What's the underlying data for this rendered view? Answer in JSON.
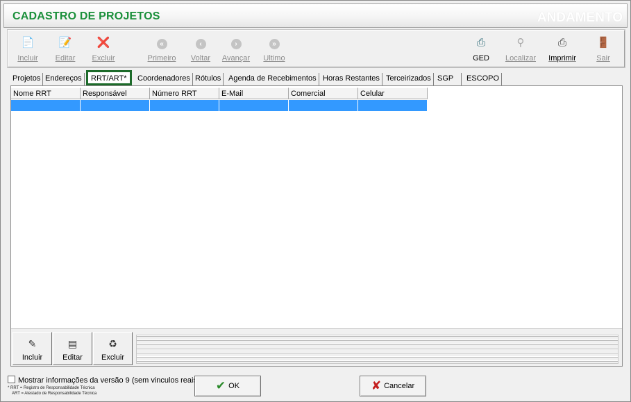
{
  "header": {
    "title": "CADASTRO DE PROJETOS",
    "status": "ANDAMENTO"
  },
  "toolbar": {
    "incluir": "Incluir",
    "editar": "Editar",
    "excluir": "Excluir",
    "primeiro": "Primeiro",
    "voltar": "Voltar",
    "avancar": "Avançar",
    "ultimo": "Ultimo",
    "ged": "GED",
    "localizar": "Localizar",
    "imprimir": "Imprimir",
    "sair": "Sair"
  },
  "tabs": [
    {
      "label": "Projetos"
    },
    {
      "label": "Endereços"
    },
    {
      "label": "RRT/ART*"
    },
    {
      "label": "Coordenadores"
    },
    {
      "label": "Rótulos"
    },
    {
      "label": "Agenda de Recebimentos"
    },
    {
      "label": "Horas Restantes"
    },
    {
      "label": "Terceirizados"
    },
    {
      "label": "SGP"
    },
    {
      "label": "ESCOPO"
    }
  ],
  "grid": {
    "columns": [
      "Nome RRT",
      "Responsável",
      "Número RRT",
      "E-Mail",
      "Comercial",
      "Celular"
    ]
  },
  "panel": {
    "incluir": "Incluir",
    "editar": "Editar",
    "excluir": "Excluir"
  },
  "footer": {
    "checkbox_label": "Mostrar informações da versão 9 (sem vinculos reais)",
    "note_rrt": "* RRT = Registro de Responsabilidade Técnica",
    "note_art": "ART = Atestado de Responsabilidade Técnica",
    "ok": "OK",
    "cancelar": "Cancelar"
  },
  "colors": {
    "title_green": "#1a8f3a",
    "selection_blue": "#3399ff",
    "tab_highlight": "#1d6b2a"
  }
}
